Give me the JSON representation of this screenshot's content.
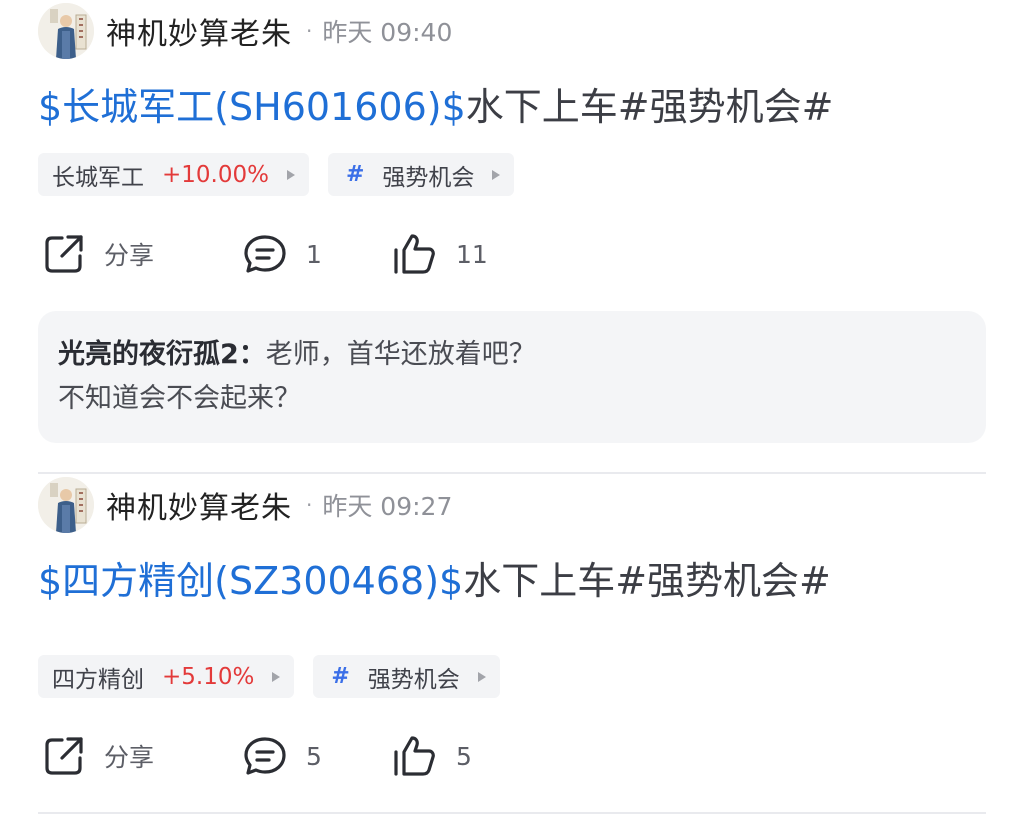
{
  "posts": [
    {
      "author": "神机妙算老朱",
      "time": "昨天 09:40",
      "title_stock": "$长城军工(SH601606)$",
      "title_text": "水下上车#强势机会#",
      "stock_tag": {
        "name": "长城军工",
        "change": "+10.00%"
      },
      "topic_tag": {
        "hash": "#",
        "name": "强势机会"
      },
      "share_label": "分享",
      "comment_count": "1",
      "like_count": "11",
      "comment": {
        "user": "光亮的夜衍孤2：",
        "text": "老师，首华还放着吧？",
        "text2": "不知道会不会起来？"
      }
    },
    {
      "author": "神机妙算老朱",
      "time": "昨天 09:27",
      "title_stock": "$四方精创(SZ300468)$",
      "title_text": "水下上车#强势机会#",
      "stock_tag": {
        "name": "四方精创",
        "change": "+5.10%"
      },
      "topic_tag": {
        "hash": "#",
        "name": "强势机会"
      },
      "share_label": "分享",
      "comment_count": "5",
      "like_count": "5"
    }
  ],
  "colors": {
    "link": "#1f6fd6",
    "up": "#e33a3a",
    "hash": "#3b6fe8"
  },
  "separator": "·"
}
